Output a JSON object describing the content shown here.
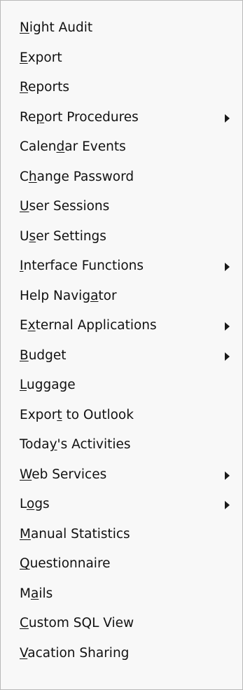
{
  "menu": {
    "items": [
      {
        "label": "Night Audit",
        "mnemonic_index": 0,
        "has_submenu": false
      },
      {
        "label": "Export",
        "mnemonic_index": 0,
        "has_submenu": false
      },
      {
        "label": "Reports",
        "mnemonic_index": 0,
        "has_submenu": false
      },
      {
        "label": "Report Procedures",
        "mnemonic_index": 2,
        "has_submenu": true
      },
      {
        "label": "Calendar Events",
        "mnemonic_index": 5,
        "has_submenu": false
      },
      {
        "label": "Change Password",
        "mnemonic_index": 1,
        "has_submenu": false
      },
      {
        "label": "User Sessions",
        "mnemonic_index": 0,
        "has_submenu": false
      },
      {
        "label": "User Settings",
        "mnemonic_index": 1,
        "has_submenu": false
      },
      {
        "label": "Interface Functions",
        "mnemonic_index": 0,
        "has_submenu": true
      },
      {
        "label": "Help Navigator",
        "mnemonic_index": 10,
        "has_submenu": false
      },
      {
        "label": "External Applications",
        "mnemonic_index": 1,
        "has_submenu": true
      },
      {
        "label": "Budget",
        "mnemonic_index": 0,
        "has_submenu": true
      },
      {
        "label": "Luggage",
        "mnemonic_index": 0,
        "has_submenu": false
      },
      {
        "label": "Export to Outlook",
        "mnemonic_index": 5,
        "has_submenu": false
      },
      {
        "label": "Today's Activities",
        "mnemonic_index": 4,
        "has_submenu": false
      },
      {
        "label": "Web Services",
        "mnemonic_index": 0,
        "has_submenu": true
      },
      {
        "label": "Logs",
        "mnemonic_index": 1,
        "has_submenu": true
      },
      {
        "label": "Manual Statistics",
        "mnemonic_index": 0,
        "has_submenu": false
      },
      {
        "label": "Questionnaire",
        "mnemonic_index": 0,
        "has_submenu": false
      },
      {
        "label": "Mails",
        "mnemonic_index": 1,
        "has_submenu": false
      },
      {
        "label": "Custom SQL View",
        "mnemonic_index": 0,
        "has_submenu": false
      },
      {
        "label": "Vacation Sharing",
        "mnemonic_index": 0,
        "has_submenu": false
      }
    ],
    "submenu_arrow_icon": "triangle-right-icon"
  }
}
